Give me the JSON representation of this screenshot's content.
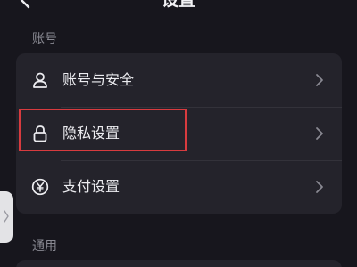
{
  "header": {
    "title": "设置",
    "back_icon": "chevron-left-icon"
  },
  "sections": {
    "account": {
      "label": "账号",
      "items": [
        {
          "label": "账号与安全",
          "icon": "user-icon"
        },
        {
          "label": "隐私设置",
          "icon": "lock-icon"
        },
        {
          "label": "支付设置",
          "icon": "yen-icon"
        }
      ]
    },
    "general": {
      "label": "通用"
    }
  },
  "colors": {
    "background": "#17161d",
    "card": "#24232b",
    "highlight": "#d83b3f",
    "section_label": "#8a8a93"
  }
}
